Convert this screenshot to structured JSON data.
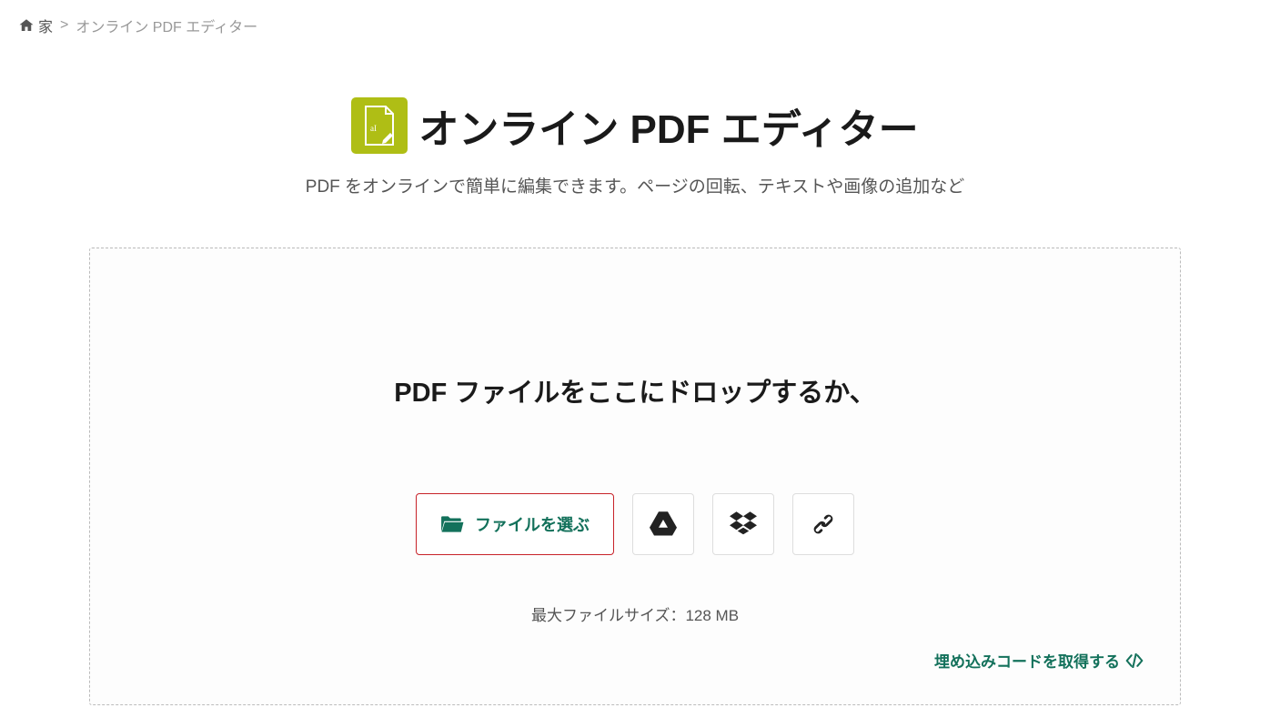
{
  "breadcrumb": {
    "home_label": "家",
    "separator": ">",
    "current": "オンライン PDF エディター"
  },
  "header": {
    "title": "オンライン PDF エディター",
    "subtitle": "PDF をオンラインで簡単に編集できます。ページの回転、テキストや画像の追加など"
  },
  "dropzone": {
    "drop_text": "PDF ファイルをここにドロップするか、",
    "choose_file_label": "ファイルを選ぶ",
    "max_size_label": "最大ファイルサイズ：128 MB",
    "embed_label": "埋め込みコードを取得する"
  },
  "icons": {
    "google_drive": "google-drive-icon",
    "dropbox": "dropbox-icon",
    "link": "link-icon"
  },
  "colors": {
    "accent_green": "#13715b",
    "logo_bg": "#afbe15",
    "button_border": "#c72229"
  }
}
